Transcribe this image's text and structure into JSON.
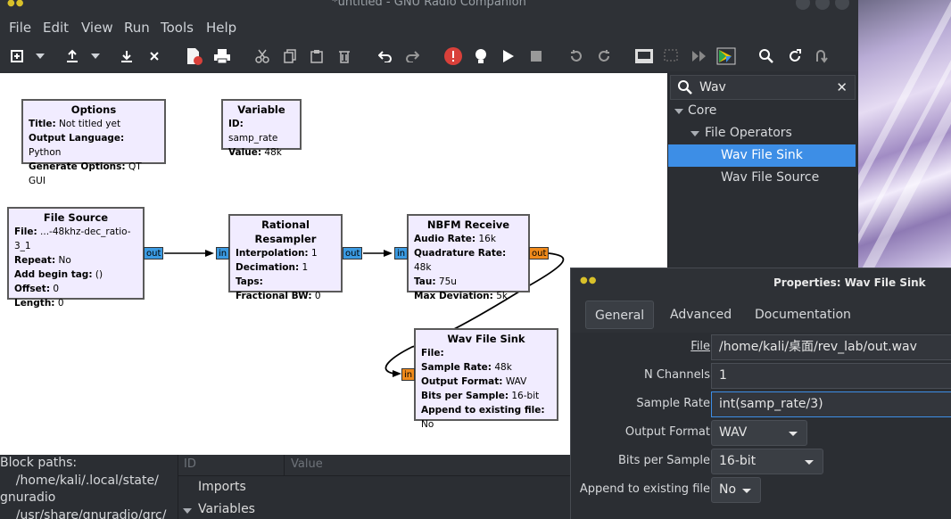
{
  "window": {
    "title": "*untitled - GNU Radio Companion"
  },
  "menu": [
    "File",
    "Edit",
    "View",
    "Run",
    "Tools",
    "Help"
  ],
  "toolbar_icons": [
    "new-icon",
    "new-dropdown-icon",
    "open-icon",
    "open-dropdown-icon",
    "save-icon",
    "save-dropdown-icon",
    "close-icon",
    "generate-report-icon",
    "print-icon",
    "cut-icon",
    "copy-icon",
    "paste-icon",
    "delete-icon",
    "undo-icon",
    "redo-icon",
    "error-icon",
    "generate-icon",
    "execute-icon",
    "stop-icon",
    "rotate-ccw-icon",
    "rotate-cw-icon",
    "enable-icon",
    "disable-icon",
    "bypass-icon",
    "create-hier-icon",
    "find-icon",
    "reload-icon",
    "open-hier-icon"
  ],
  "blocks": {
    "options": {
      "title": "Options",
      "rows": [
        [
          "Title:",
          "Not titled yet"
        ],
        [
          "Output Language:",
          "Python"
        ],
        [
          "Generate Options:",
          "QT GUI"
        ]
      ]
    },
    "variable": {
      "title": "Variable",
      "rows": [
        [
          "ID:",
          "samp_rate"
        ],
        [
          "Value:",
          "48k"
        ]
      ]
    },
    "file_source": {
      "title": "File Source",
      "rows": [
        [
          "File:",
          "...-48khz-dec_ratio-3_1"
        ],
        [
          "Repeat:",
          "No"
        ],
        [
          "Add begin tag:",
          "()"
        ],
        [
          "Offset:",
          "0"
        ],
        [
          "Length:",
          "0"
        ]
      ]
    },
    "resampler": {
      "title": "Rational Resampler",
      "rows": [
        [
          "Interpolation:",
          "1"
        ],
        [
          "Decimation:",
          "1"
        ],
        [
          "Taps:",
          ""
        ],
        [
          "Fractional BW:",
          "0"
        ]
      ]
    },
    "nbfm": {
      "title": "NBFM Receive",
      "rows": [
        [
          "Audio Rate:",
          "16k"
        ],
        [
          "Quadrature Rate:",
          "48k"
        ],
        [
          "Tau:",
          "75u"
        ],
        [
          "Max Deviation:",
          "5k"
        ]
      ]
    },
    "wav_sink": {
      "title": "Wav File Sink",
      "rows": [
        [
          "File:",
          ""
        ],
        [
          "Sample Rate:",
          "48k"
        ],
        [
          "Output Format:",
          "WAV"
        ],
        [
          "Bits per Sample:",
          "16-bit"
        ],
        [
          "Append to existing file:",
          "No"
        ]
      ]
    }
  },
  "ports": {
    "out": "out",
    "in": "in"
  },
  "search": {
    "value": "Wav",
    "clear": "✕"
  },
  "tree": {
    "core": "Core",
    "file_operators": "File Operators",
    "items": [
      "Wav File Sink",
      "Wav File Source"
    ]
  },
  "console": {
    "lines": [
      "Block paths:",
      "    /home/kali/.local/state/",
      "gnuradio",
      "    /usr/share/gnuradio/grc/"
    ]
  },
  "variables_panel": {
    "col_id": "ID",
    "col_value": "Value",
    "rows": [
      "Imports",
      "Variables"
    ]
  },
  "props": {
    "title": "Properties: Wav File Sink",
    "tabs": [
      "General",
      "Advanced",
      "Documentation"
    ],
    "fields": {
      "file_label": "File",
      "file_value": "/home/kali/桌面/rev_lab/out.wav",
      "nch_label": "N Channels",
      "nch_value": "1",
      "sr_label": "Sample Rate",
      "sr_value": "int(samp_rate/3)",
      "fmt_label": "Output Format",
      "fmt_value": "WAV",
      "bps_label": "Bits per Sample",
      "bps_value": "16-bit",
      "append_label": "Append to existing file",
      "append_value": "No"
    }
  },
  "colors": {
    "canvas": "#ffffff",
    "block_fill": "#f1ecff",
    "complex_port": "#3b9ae1",
    "float_port": "#f08a1c",
    "selection": "#3d8ee6",
    "error": "#d9403a"
  }
}
